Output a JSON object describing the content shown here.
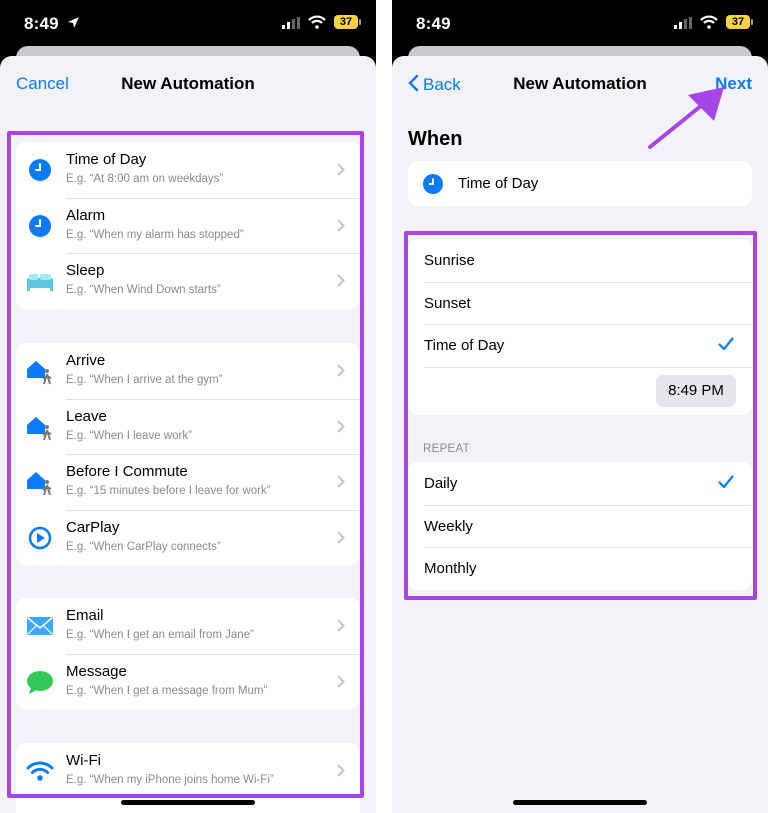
{
  "colors": {
    "accent": "#0a7aff",
    "highlight": "#a646e8",
    "background": "#f2f2f7",
    "battery": "#f6d33c"
  },
  "status": {
    "time": "8:49",
    "battery": "37"
  },
  "left": {
    "nav": {
      "cancel": "Cancel",
      "title": "New Automation"
    },
    "groups": [
      {
        "items": [
          {
            "icon": "clock-icon",
            "title": "Time of Day",
            "subtitle": "E.g. “At 8:00 am on weekdays”"
          },
          {
            "icon": "alarm-icon",
            "title": "Alarm",
            "subtitle": "E.g. “When my alarm has stopped”"
          },
          {
            "icon": "bed-icon",
            "title": "Sleep",
            "subtitle": "E.g. “When Wind Down starts”"
          }
        ]
      },
      {
        "items": [
          {
            "icon": "arrive-icon",
            "title": "Arrive",
            "subtitle": "E.g. “When I arrive at the gym”"
          },
          {
            "icon": "leave-icon",
            "title": "Leave",
            "subtitle": "E.g. “When I leave work”"
          },
          {
            "icon": "commute-icon",
            "title": "Before I Commute",
            "subtitle": "E.g. “15 minutes before I leave for work”"
          },
          {
            "icon": "carplay-icon",
            "title": "CarPlay",
            "subtitle": "E.g. “When CarPlay connects”"
          }
        ]
      },
      {
        "items": [
          {
            "icon": "mail-icon",
            "title": "Email",
            "subtitle": "E.g. “When I get an email from Jane”"
          },
          {
            "icon": "message-icon",
            "title": "Message",
            "subtitle": "E.g. “When I get a message from Mum”"
          }
        ]
      },
      {
        "items": [
          {
            "icon": "wifi-icon",
            "title": "Wi-Fi",
            "subtitle": "E.g. “When my iPhone joins home Wi-Fi”"
          }
        ]
      }
    ]
  },
  "right": {
    "nav": {
      "back": "Back",
      "title": "New Automation",
      "next": "Next"
    },
    "when_label": "When",
    "when_value": "Time of Day",
    "options": [
      {
        "label": "Sunrise",
        "checked": false
      },
      {
        "label": "Sunset",
        "checked": false
      },
      {
        "label": "Time of Day",
        "checked": true
      }
    ],
    "time_value": "8:49 PM",
    "repeat_label": "REPEAT",
    "repeat_options": [
      {
        "label": "Daily",
        "checked": true
      },
      {
        "label": "Weekly",
        "checked": false
      },
      {
        "label": "Monthly",
        "checked": false
      }
    ]
  }
}
